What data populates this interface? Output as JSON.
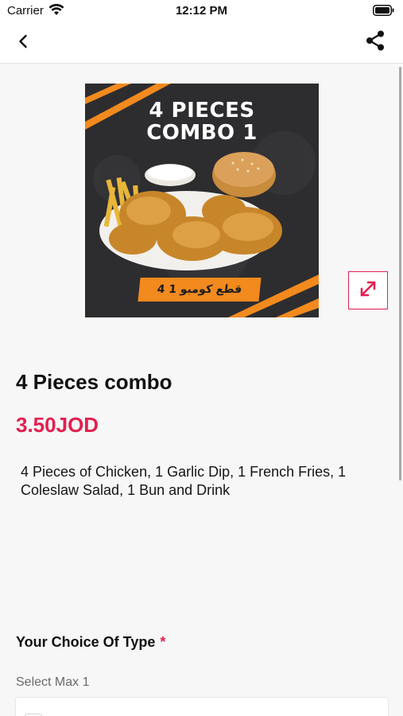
{
  "status_bar": {
    "carrier": "Carrier",
    "time": "12:12 PM"
  },
  "nav": {
    "back_icon": "chevron-left-icon",
    "share_icon": "share-icon"
  },
  "product": {
    "image": {
      "title_line1": "4 PIECES",
      "title_line2": "COMBO 1",
      "banner_text": "4 قطع كومبو 1"
    },
    "expand_icon": "expand-arrows-icon",
    "name": "4 Pieces combo",
    "price": "3.50JOD",
    "description": "4 Pieces of Chicken, 1 Garlic Dip, 1 French Fries, 1 Coleslaw Salad, 1 Bun and Drink"
  },
  "choice": {
    "title": "Your Choice Of Type",
    "required_marker": "*",
    "subtitle": "Select Max 1"
  },
  "colors": {
    "accent": "#e3204f",
    "orange": "#f28a1e",
    "background": "#f7f7f7"
  }
}
